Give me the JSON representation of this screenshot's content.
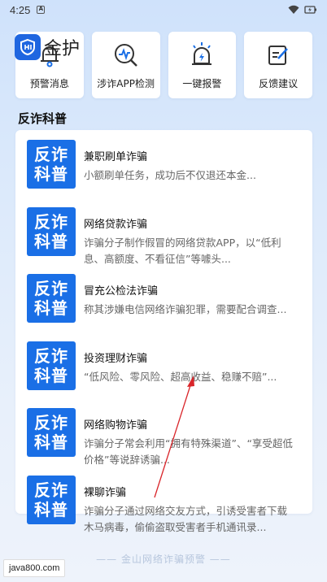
{
  "status_bar": {
    "time": "4:25",
    "notif_badge": "A"
  },
  "app": {
    "logo_text": "金护"
  },
  "quick_actions": [
    {
      "label": "预警消息",
      "icon": "bell-icon"
    },
    {
      "label": "涉诈APP检测",
      "icon": "app-scan-icon"
    },
    {
      "label": "一键报警",
      "icon": "alarm-light-icon"
    },
    {
      "label": "反馈建议",
      "icon": "feedback-edit-icon"
    }
  ],
  "section": {
    "title": "反诈科普"
  },
  "thumb_text": {
    "line1": "反诈",
    "line2": "科普"
  },
  "articles": [
    {
      "title": "兼职刷单诈骗",
      "desc": "小额刷单任务，成功后不仅退还本金..."
    },
    {
      "title": "网络贷款诈骗",
      "desc": "诈骗分子制作假冒的网络贷款APP，以“低利息、高额度、不看征信”等噱头..."
    },
    {
      "title": "冒充公检法诈骗",
      "desc": "称其涉嫌电信网络诈骗犯罪，需要配合调查..."
    },
    {
      "title": "投资理财诈骗",
      "desc": "“低风险、零风险、超高收益、稳赚不赔”..."
    },
    {
      "title": "网络购物诈骗",
      "desc": "诈骗分子常会利用“拥有特殊渠道”、“享受超低价格”等说辞诱骗..."
    },
    {
      "title": "裸聊诈骗",
      "desc": "诈骗分子通过网络交友方式，引诱受害者下载木马病毒，偷偷盗取受害者手机通讯录..."
    }
  ],
  "footer": {
    "slogan": "—— 金山网络诈骗预警 ——"
  },
  "watermark": {
    "text": "java800.com"
  },
  "colors": {
    "brand_blue": "#1a6fe6",
    "annotation_red": "#d9252a"
  }
}
